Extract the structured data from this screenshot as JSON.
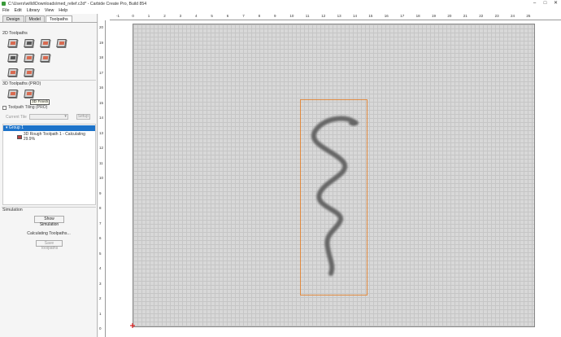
{
  "window": {
    "title": "C:\\Users\\willd\\Downloads\\med_relief.c2d* - Carbide Create Pro, Build 854",
    "controls": [
      "–",
      "□",
      "✕"
    ]
  },
  "menu": [
    "File",
    "Edit",
    "Library",
    "View",
    "Help"
  ],
  "tabs": [
    "Design",
    "Model",
    "Toolpaths"
  ],
  "active_tab": "Toolpaths",
  "sections": {
    "toolpaths_2d": "2D Toolpaths",
    "toolpaths_3d": "3D Toolpaths (PRO)",
    "tooltip": "3D Finish",
    "toolpath_tiling": "Toolpath Tiling (PRO)",
    "current_tile_label": "Current Tile",
    "setup_button": "Setup"
  },
  "tree": {
    "group": "Group 1",
    "item": "3D Rough Toolpath 1 - Calculating 29.9%"
  },
  "simulation": {
    "heading": "Simulation",
    "show_button": "Show Simulation",
    "status": "Calculating Toolpaths...",
    "save_button": "Save Toolpaths"
  },
  "ruler": {
    "top": [
      "-1",
      "0",
      "1",
      "2",
      "3",
      "4",
      "5",
      "6",
      "7",
      "8",
      "9",
      "10",
      "11",
      "12",
      "13",
      "14",
      "15",
      "16",
      "17",
      "18",
      "19",
      "20",
      "21",
      "22",
      "23",
      "24",
      "25"
    ],
    "left": [
      "20",
      "19",
      "18",
      "17",
      "16",
      "15",
      "14",
      "13",
      "12",
      "11",
      "10",
      "9",
      "8",
      "7",
      "6",
      "5",
      "4",
      "3",
      "2",
      "1",
      "0"
    ]
  },
  "colors": {
    "selection_blue": "#1d73c9",
    "bbox_orange": "#e08a40",
    "icon_accent": "#d96a50"
  }
}
